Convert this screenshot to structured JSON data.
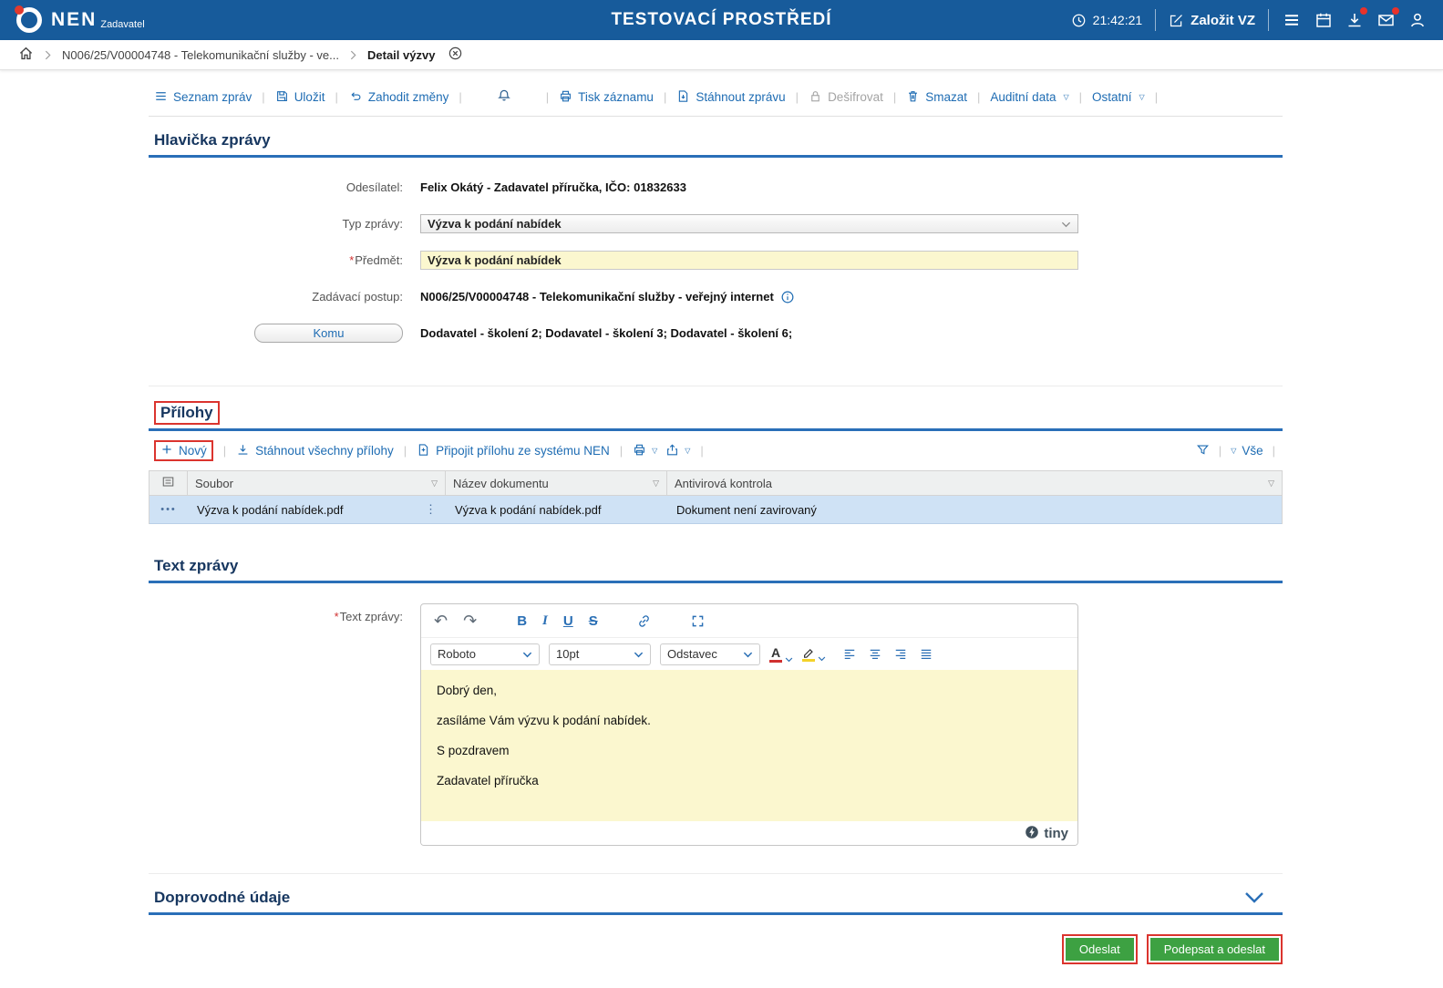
{
  "colors": {
    "header_bg": "#175b9b",
    "accent_blue": "#1e6cb3",
    "section_title": "#16365f",
    "required_field_bg": "#fbf7cf",
    "selected_row_bg": "#cfe2f5",
    "button_green": "#3da142",
    "annotation_red": "#db342e"
  },
  "header": {
    "brand": "NEN",
    "brand_sub": "Zadavatel",
    "env_title": "TESTOVACÍ PROSTŘEDÍ",
    "time": "21:42:21",
    "create_button": "Založit VZ"
  },
  "breadcrumb": {
    "procedure": "N006/25/V00004748 - Telekomunikační služby - ve...",
    "current": "Detail výzvy"
  },
  "cmdbar": {
    "seznam": "Seznam zpráv",
    "ulozit": "Uložit",
    "zahodit": "Zahodit změny",
    "tisk": "Tisk záznamu",
    "stahnout": "Stáhnout zprávu",
    "desifrovat": "Dešifrovat",
    "smazat": "Smazat",
    "auditni": "Auditní data",
    "ostatni": "Ostatní"
  },
  "message_header": {
    "title": "Hlavička zprávy",
    "sender_label": "Odesílatel:",
    "sender_value": "Felix Okátý - Zadavatel příručka, IČO: 01832633",
    "type_label": "Typ zprávy:",
    "type_value": "Výzva k podání nabídek",
    "subject_label": "Předmět:",
    "subject_value": "Výzva k podání nabídek",
    "procedure_label": "Zadávací postup:",
    "procedure_value": "N006/25/V00004748 - Telekomunikační služby - veřejný internet",
    "to_button": "Komu",
    "to_value": "Dodavatel - školení 2; Dodavatel - školení 3; Dodavatel - školení 6;"
  },
  "attachments": {
    "title": "Přílohy",
    "new_button": "Nový",
    "download_all": "Stáhnout všechny přílohy",
    "attach_from_nen": "Připojit přílohu ze systému NEN",
    "all_filter": "Vše",
    "columns": [
      "Soubor",
      "Název dokumentu",
      "Antivirová kontrola"
    ],
    "rows": [
      {
        "file": "Výzva k podání nabídek.pdf",
        "doc_name": "Výzva k podání nabídek.pdf",
        "antivirus": "Dokument není zavirovaný"
      }
    ]
  },
  "message_text": {
    "title": "Text zprávy",
    "label": "Text zprávy:",
    "editor": {
      "font": "Roboto",
      "size": "10pt",
      "block": "Odstavec",
      "paragraphs": [
        "Dobrý den,",
        "zasíláme Vám výzvu k podání nabídek.",
        "S pozdravem",
        "Zadavatel příručka"
      ],
      "brand": "tiny"
    }
  },
  "icons": {
    "bold": "B",
    "italic": "I",
    "underline": "U",
    "strikethrough": "S",
    "text_color": "A"
  },
  "additional": {
    "title": "Doprovodné údaje"
  },
  "footer": {
    "send": "Odeslat",
    "sign_and_send": "Podepsat a odeslat"
  }
}
